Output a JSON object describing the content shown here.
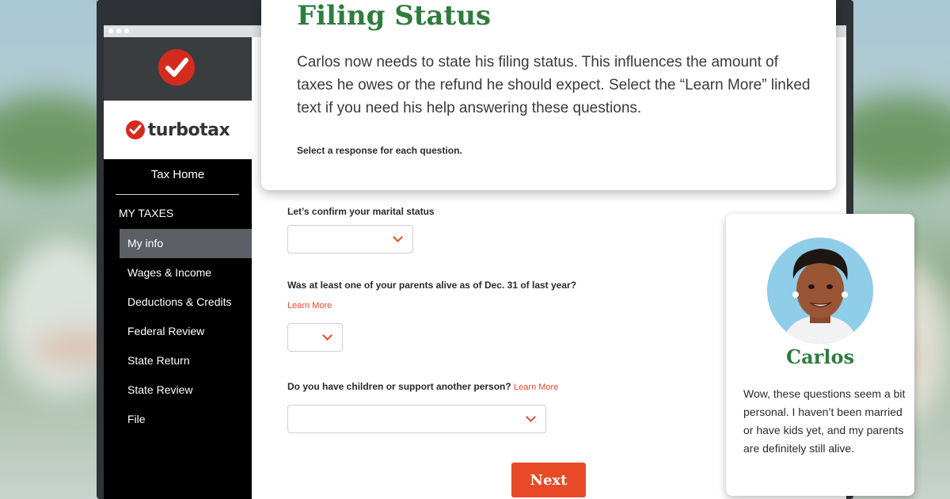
{
  "sidebar": {
    "brand": "turbotax",
    "tax_home": "Tax Home",
    "section": "MY TAXES",
    "items": [
      {
        "label": "My info",
        "active": true
      },
      {
        "label": "Wages & Income"
      },
      {
        "label": "Deductions & Credits"
      },
      {
        "label": "Federal Review"
      },
      {
        "label": "State Return"
      },
      {
        "label": "State Review"
      },
      {
        "label": "File"
      }
    ]
  },
  "card": {
    "title": "Filing Status",
    "body": "Carlos now needs to state his filing status. This influences the amount of taxes he owes or the refund he should expect. Select the “Learn More” linked text if you need his help answering these questions.",
    "instruction": "Select a response for each question."
  },
  "questions": [
    {
      "label": "Let’s confirm your marital status",
      "value": ""
    },
    {
      "label": "Was at least one of your parents alive as of Dec. 31 of last year?",
      "learn_more": "Learn More",
      "value": ""
    },
    {
      "label": "Do you have children or support another person?",
      "learn_more": "Learn More",
      "value": ""
    }
  ],
  "next_label": "Next",
  "character": {
    "name": "Carlos",
    "speech": "Wow, these questions seem a bit personal. I haven’t been married or have kids yet, and my parents are definitely still alive."
  },
  "colors": {
    "accent": "#e84a27",
    "title_green": "#2e7d3e",
    "brand_red": "#d52b1e"
  }
}
